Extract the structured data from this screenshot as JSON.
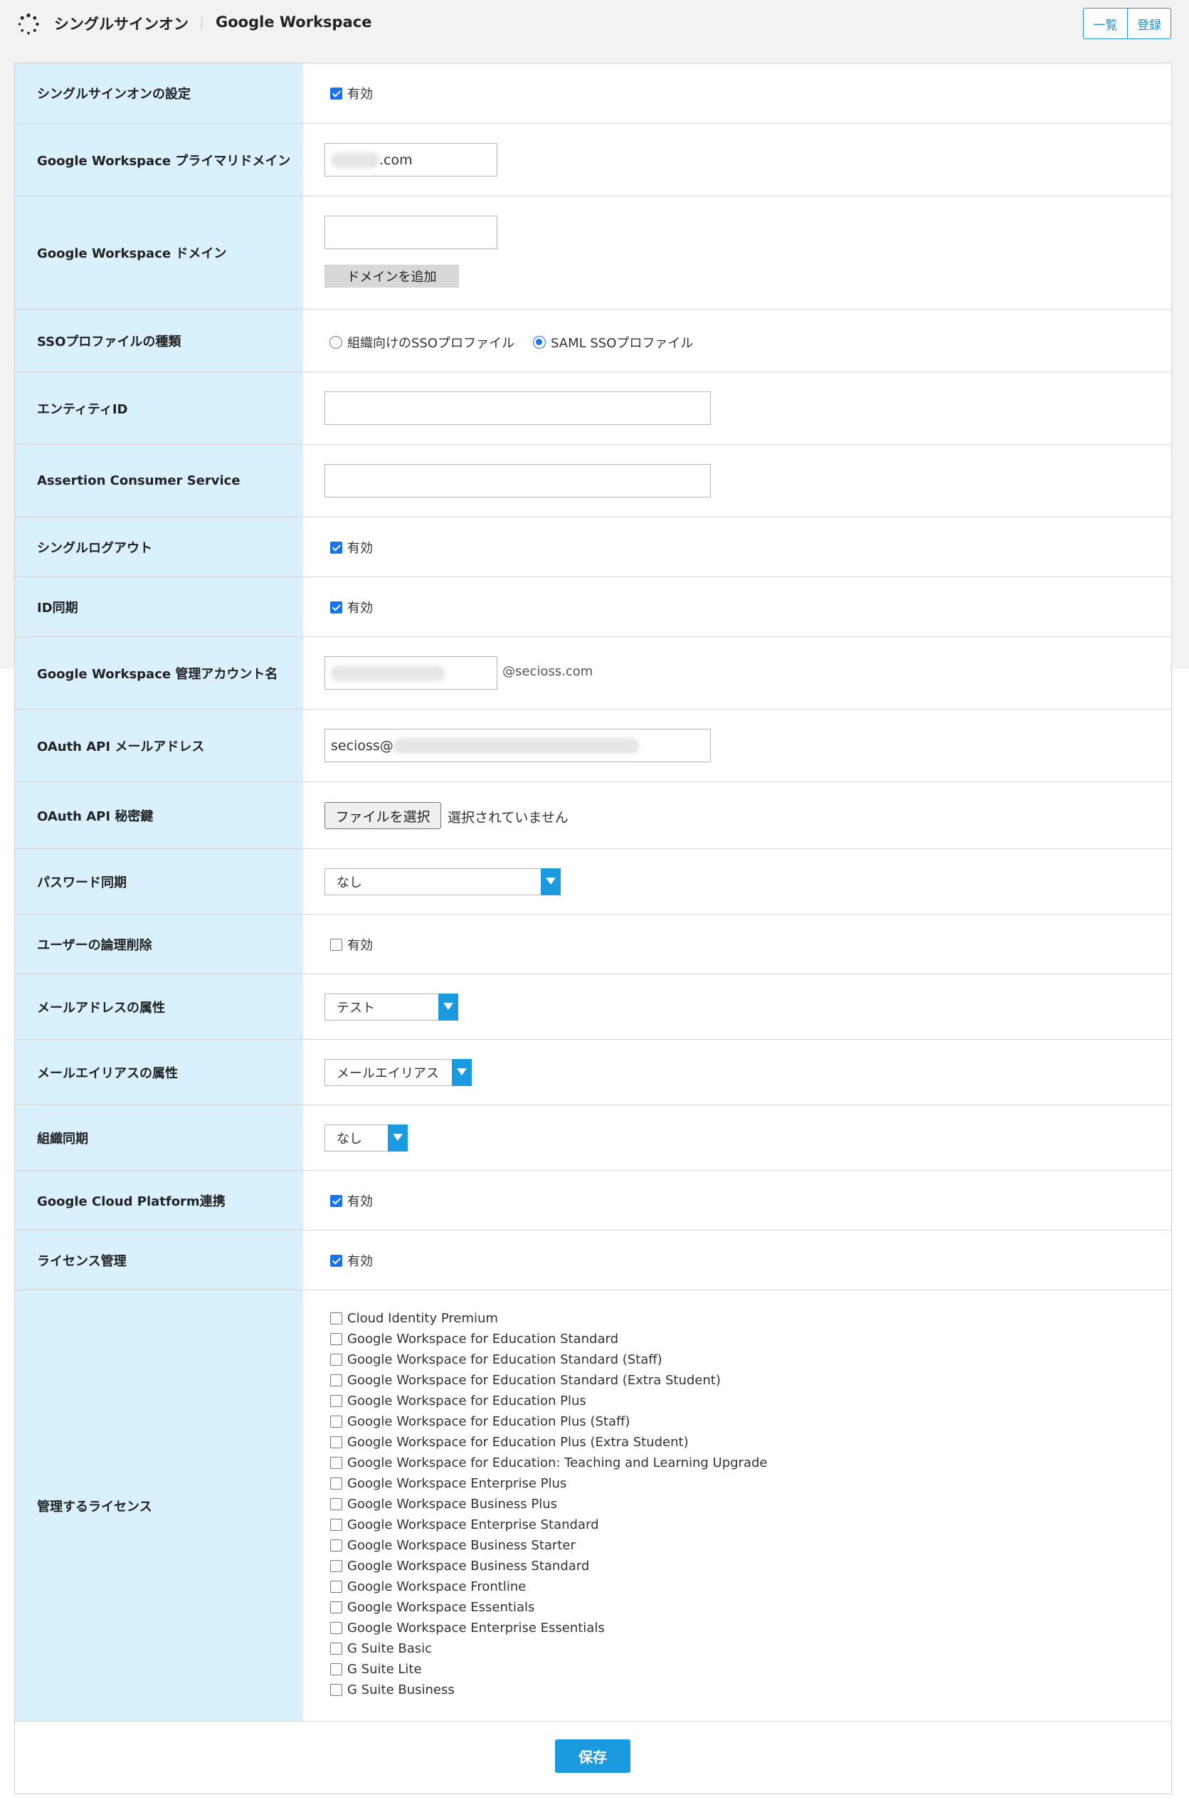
{
  "header": {
    "app_title": "シングルサインオン",
    "page_title": "Google Workspace",
    "list_button": "一覧",
    "register_button": "登録"
  },
  "rows": {
    "sso_setting": {
      "label": "シングルサインオンの設定",
      "checkbox_label": "有効",
      "checked": true
    },
    "primary_domain": {
      "label": "Google Workspace プライマリドメイン",
      "value_suffix": ".com"
    },
    "domain": {
      "label": "Google Workspace ドメイン",
      "value": "",
      "add_button": "ドメインを追加"
    },
    "sso_profile": {
      "label": "SSOプロファイルの種類",
      "option_org": "組織向けのSSOプロファイル",
      "option_saml": "SAML SSOプロファイル",
      "selected": "saml"
    },
    "entity_id": {
      "label": "エンティティID",
      "value": ""
    },
    "acs": {
      "label": "Assertion Consumer Service",
      "value": ""
    },
    "single_logout": {
      "label": "シングルログアウト",
      "checkbox_label": "有効",
      "checked": true
    },
    "id_sync": {
      "label": "ID同期",
      "checkbox_label": "有効",
      "checked": true
    },
    "admin_account": {
      "label": "Google Workspace 管理アカウント名",
      "suffix": "@secioss.com"
    },
    "oauth_email": {
      "label": "OAuth API メールアドレス",
      "value_prefix": "secioss@"
    },
    "oauth_key": {
      "label": "OAuth API 秘密鍵",
      "file_button": "ファイルを選択",
      "file_status": "選択されていません"
    },
    "password_sync": {
      "label": "パスワード同期",
      "selected": "なし"
    },
    "logical_delete": {
      "label": "ユーザーの論理削除",
      "checkbox_label": "有効",
      "checked": false
    },
    "mail_attr": {
      "label": "メールアドレスの属性",
      "selected": "テスト"
    },
    "alias_attr": {
      "label": "メールエイリアスの属性",
      "selected": "メールエイリアス"
    },
    "org_sync": {
      "label": "組織同期",
      "selected": "なし"
    },
    "gcp": {
      "label": "Google Cloud Platform連携",
      "checkbox_label": "有効",
      "checked": true
    },
    "license_mgmt": {
      "label": "ライセンス管理",
      "checkbox_label": "有効",
      "checked": true
    },
    "licenses": {
      "label": "管理するライセンス",
      "items": [
        "Cloud Identity Premium",
        "Google Workspace for Education Standard",
        "Google Workspace for Education Standard (Staff)",
        "Google Workspace for Education Standard (Extra Student)",
        "Google Workspace for Education Plus",
        "Google Workspace for Education Plus (Staff)",
        "Google Workspace for Education Plus (Extra Student)",
        "Google Workspace for Education: Teaching and Learning Upgrade",
        "Google Workspace Enterprise Plus",
        "Google Workspace Business Plus",
        "Google Workspace Enterprise Standard",
        "Google Workspace Business Starter",
        "Google Workspace Business Standard",
        "Google Workspace Frontline",
        "Google Workspace Essentials",
        "Google Workspace Enterprise Essentials",
        "G Suite Basic",
        "G Suite Lite",
        "G Suite Business"
      ]
    }
  },
  "footer": {
    "save_button": "保存"
  },
  "colors": {
    "accent": "#1b9ae0",
    "label_bg": "#d9f0fd",
    "checkbox_on": "#1a73e8"
  }
}
